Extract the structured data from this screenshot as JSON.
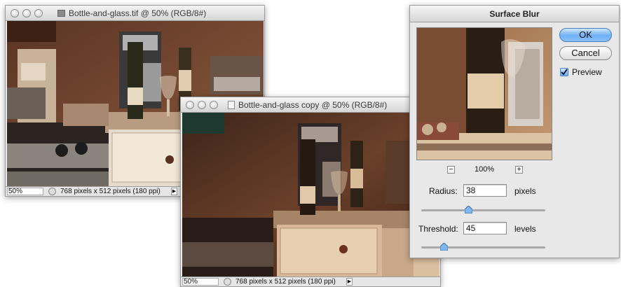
{
  "window1": {
    "title": "Bottle-and-glass.tif @ 50% (RGB/8#)",
    "zoom": "50%",
    "info": "768 pixels x 512 pixels (180 ppi)"
  },
  "window2": {
    "title": "Bottle-and-glass copy @ 50% (RGB/8#)",
    "zoom": "50%",
    "info": "768 pixels x 512 pixels (180 ppi)"
  },
  "dialog": {
    "title": "Surface Blur",
    "ok_label": "OK",
    "cancel_label": "Cancel",
    "preview_label": "Preview",
    "preview_checked": true,
    "zoom_level": "100%",
    "zoom_out": "−",
    "zoom_in": "+",
    "radius": {
      "label": "Radius:",
      "value": "38",
      "unit": "pixels",
      "slider_fraction": 0.38
    },
    "threshold": {
      "label": "Threshold:",
      "value": "45",
      "unit": "levels",
      "slider_fraction": 0.18
    }
  },
  "colors": {
    "accent": "#6fb0f4",
    "photo_tone": "#8a5a3a"
  }
}
